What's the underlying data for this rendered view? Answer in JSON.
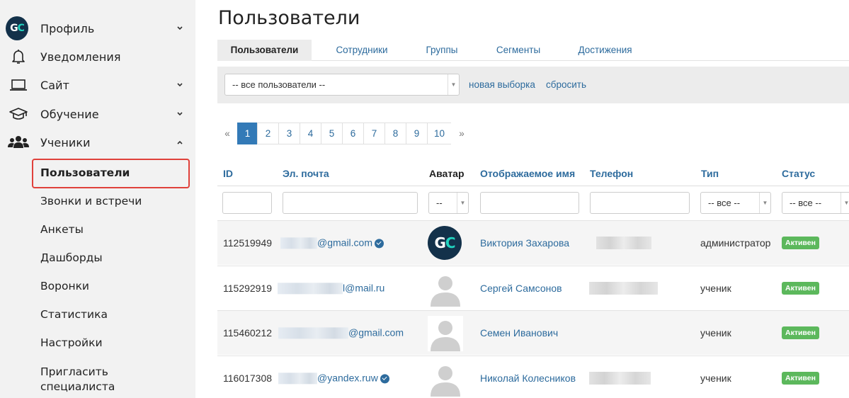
{
  "sidebar": {
    "items": [
      {
        "label": "Профиль",
        "icon": "gc-logo-icon",
        "chevron": "down"
      },
      {
        "label": "Уведомления",
        "icon": "bell-icon"
      },
      {
        "label": "Сайт",
        "icon": "laptop-icon",
        "chevron": "down"
      },
      {
        "label": "Обучение",
        "icon": "graduation-cap-icon",
        "chevron": "down"
      },
      {
        "label": "Ученики",
        "icon": "users-icon",
        "chevron": "up"
      }
    ],
    "logo_text": {
      "g": "G",
      "c": "C"
    },
    "subitems": [
      "Пользователи",
      "Звонки и встречи",
      "Анкеты",
      "Дашборды",
      "Воронки",
      "Статистика",
      "Настройки"
    ],
    "invite": {
      "line1": "Пригласить",
      "line2": "специалиста"
    }
  },
  "main": {
    "title": "Пользователи",
    "tabs": [
      "Пользователи",
      "Сотрудники",
      "Группы",
      "Сегменты",
      "Достижения"
    ],
    "filter": {
      "select_value": "-- все пользователи --",
      "new_selection": "новая выборка",
      "reset": "сбросить"
    },
    "pagination": {
      "prev": "«",
      "pages": [
        "1",
        "2",
        "3",
        "4",
        "5",
        "6",
        "7",
        "8",
        "9",
        "10"
      ],
      "next": "»",
      "active": "1"
    },
    "table": {
      "headers": {
        "id": "ID",
        "email": "Эл. почта",
        "avatar": "Аватар",
        "name": "Отображаемое имя",
        "phone": "Телефон",
        "type": "Тип",
        "status": "Статус"
      },
      "filters": {
        "avatar_select": "--",
        "type_select": "-- все --",
        "status_select": "-- все --"
      },
      "rows": [
        {
          "id": "112519949",
          "email_suffix": "@gmail.com",
          "verified": true,
          "name": "Виктория Захарова",
          "type": "администратор",
          "status": "Активен"
        },
        {
          "id": "115292919",
          "email_suffix": "l@mail.ru",
          "verified": false,
          "name": "Сергей Самсонов",
          "type": "ученик",
          "status": "Активен"
        },
        {
          "id": "115460212",
          "email_suffix": "@gmail.com",
          "verified": false,
          "name": "Семен Иванович",
          "type": "ученик",
          "status": "Активен"
        },
        {
          "id": "116017308",
          "email_suffix": "@yandex.ruw",
          "verified": true,
          "name": "Николай Колесников",
          "type": "ученик",
          "status": "Активен"
        }
      ]
    }
  },
  "colors": {
    "accent": "#2d6b9d",
    "active_page": "#337ab7",
    "status_badge": "#5cb85c",
    "highlight": "#e0413b",
    "logo_bg": "#13314a",
    "logo_c": "#21d3bf"
  }
}
